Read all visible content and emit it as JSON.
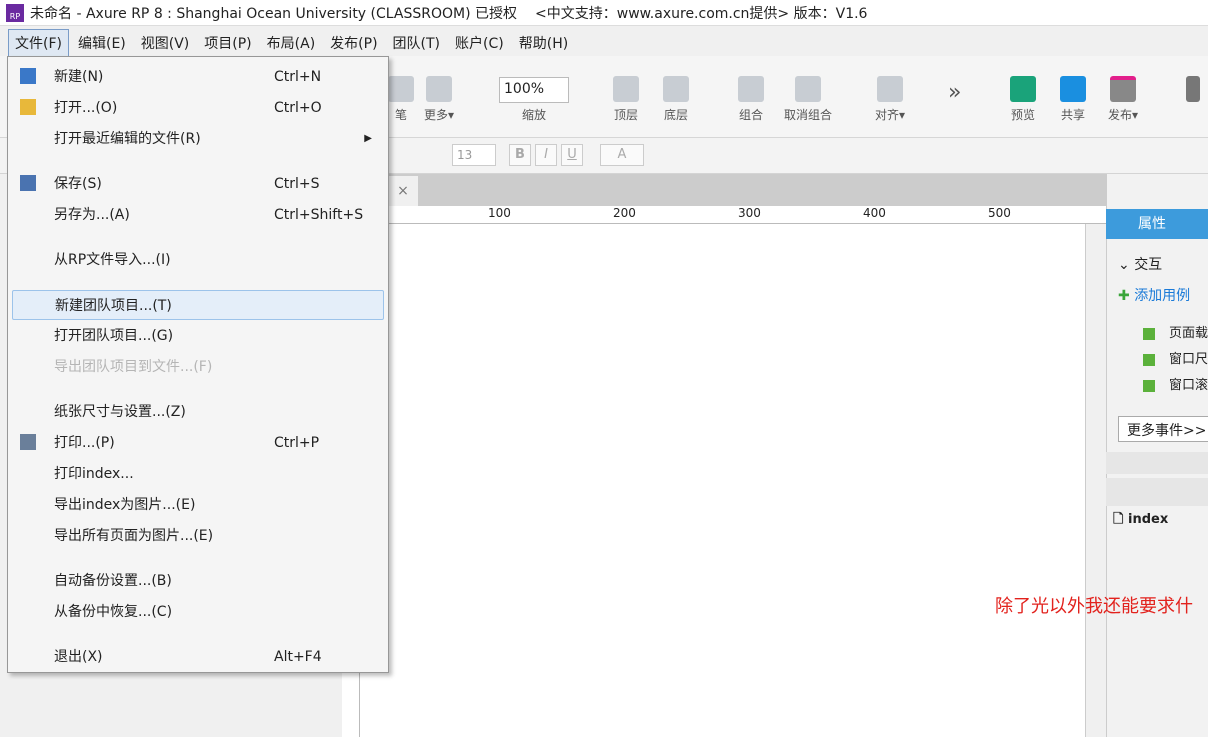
{
  "title": {
    "app": "未命名 - Axure RP 8 : Shanghai Ocean University (CLASSROOM) 已授权",
    "info": "<中文支持：www.axure.com.cn提供> 版本：V1.6",
    "logo": "RP"
  },
  "menus": [
    "文件(F)",
    "编辑(E)",
    "视图(V)",
    "项目(P)",
    "布局(A)",
    "发布(P)",
    "团队(T)",
    "账户(C)",
    "帮助(H)"
  ],
  "toolbar": {
    "pen": "笔",
    "more": "更多▾",
    "zoom": "100%",
    "zoom_label": "缩放",
    "top": "顶层",
    "bottom": "底层",
    "group": "组合",
    "ungroup": "取消组合",
    "align": "对齐▾",
    "preview": "预览",
    "share": "共享",
    "publish": "发布▾"
  },
  "format": {
    "font_size": "13",
    "bold": "B",
    "italic": "I",
    "underline": "U",
    "font_color": "A"
  },
  "ruler": [
    "100",
    "200",
    "300",
    "400",
    "500"
  ],
  "tab_close": "×",
  "panel": {
    "tab": "属性",
    "interactions": "交互",
    "add_case": "添加用例",
    "events": [
      "页面载",
      "窗口尺",
      "窗口滚"
    ],
    "more_events": "更多事件>>",
    "page": "index"
  },
  "promo": "除了光以外我还能要求什",
  "file_menu": [
    {
      "label": "新建(N)",
      "shortcut": "Ctrl+N",
      "icon": "new-file-icon"
    },
    {
      "label": "打开...(O)",
      "shortcut": "Ctrl+O",
      "icon": "folder-open-icon"
    },
    {
      "label": "打开最近编辑的文件(R)",
      "shortcut": "",
      "submenu": true
    },
    {
      "label": "保存(S)",
      "shortcut": "Ctrl+S",
      "icon": "save-icon"
    },
    {
      "label": "另存为...(A)",
      "shortcut": "Ctrl+Shift+S"
    },
    {
      "label": "从RP文件导入...(I)",
      "shortcut": ""
    },
    {
      "label": "新建团队项目...(T)",
      "shortcut": "",
      "highlighted": true
    },
    {
      "label": "打开团队项目...(G)",
      "shortcut": ""
    },
    {
      "label": "导出团队项目到文件...(F)",
      "shortcut": "",
      "disabled": true
    },
    {
      "label": "纸张尺寸与设置...(Z)",
      "shortcut": ""
    },
    {
      "label": "打印...(P)",
      "shortcut": "Ctrl+P",
      "icon": "print-icon"
    },
    {
      "label": "打印index...",
      "shortcut": ""
    },
    {
      "label": "导出index为图片...(E)",
      "shortcut": ""
    },
    {
      "label": "导出所有页面为图片...(E)",
      "shortcut": ""
    },
    {
      "label": "自动备份设置...(B)",
      "shortcut": ""
    },
    {
      "label": "从备份中恢复...(C)",
      "shortcut": ""
    },
    {
      "label": "退出(X)",
      "shortcut": "Alt+F4"
    }
  ]
}
